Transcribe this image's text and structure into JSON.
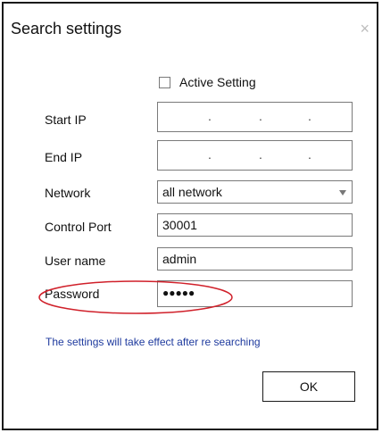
{
  "dialog": {
    "title": "Search settings",
    "close_glyph": "×"
  },
  "active_setting": {
    "label": "Active Setting",
    "checked": false
  },
  "fields": {
    "start_ip": {
      "label": "Start IP",
      "dots": [
        ".",
        ".",
        "."
      ]
    },
    "end_ip": {
      "label": "End IP",
      "dots": [
        ".",
        ".",
        "."
      ]
    },
    "network": {
      "label": "Network",
      "value": "all network"
    },
    "control_port": {
      "label": "Control Port",
      "value": "30001"
    },
    "user_name": {
      "label": "User name",
      "value": "admin"
    },
    "password": {
      "label": "Password",
      "value": "●●●●●"
    }
  },
  "note": "The settings will take effect after re searching",
  "ok_label": "OK",
  "colors": {
    "note_text": "#1e3a9e",
    "annotation": "#d0202a"
  },
  "icons": {
    "close": "close-icon",
    "dropdown": "chevron-down-icon"
  }
}
